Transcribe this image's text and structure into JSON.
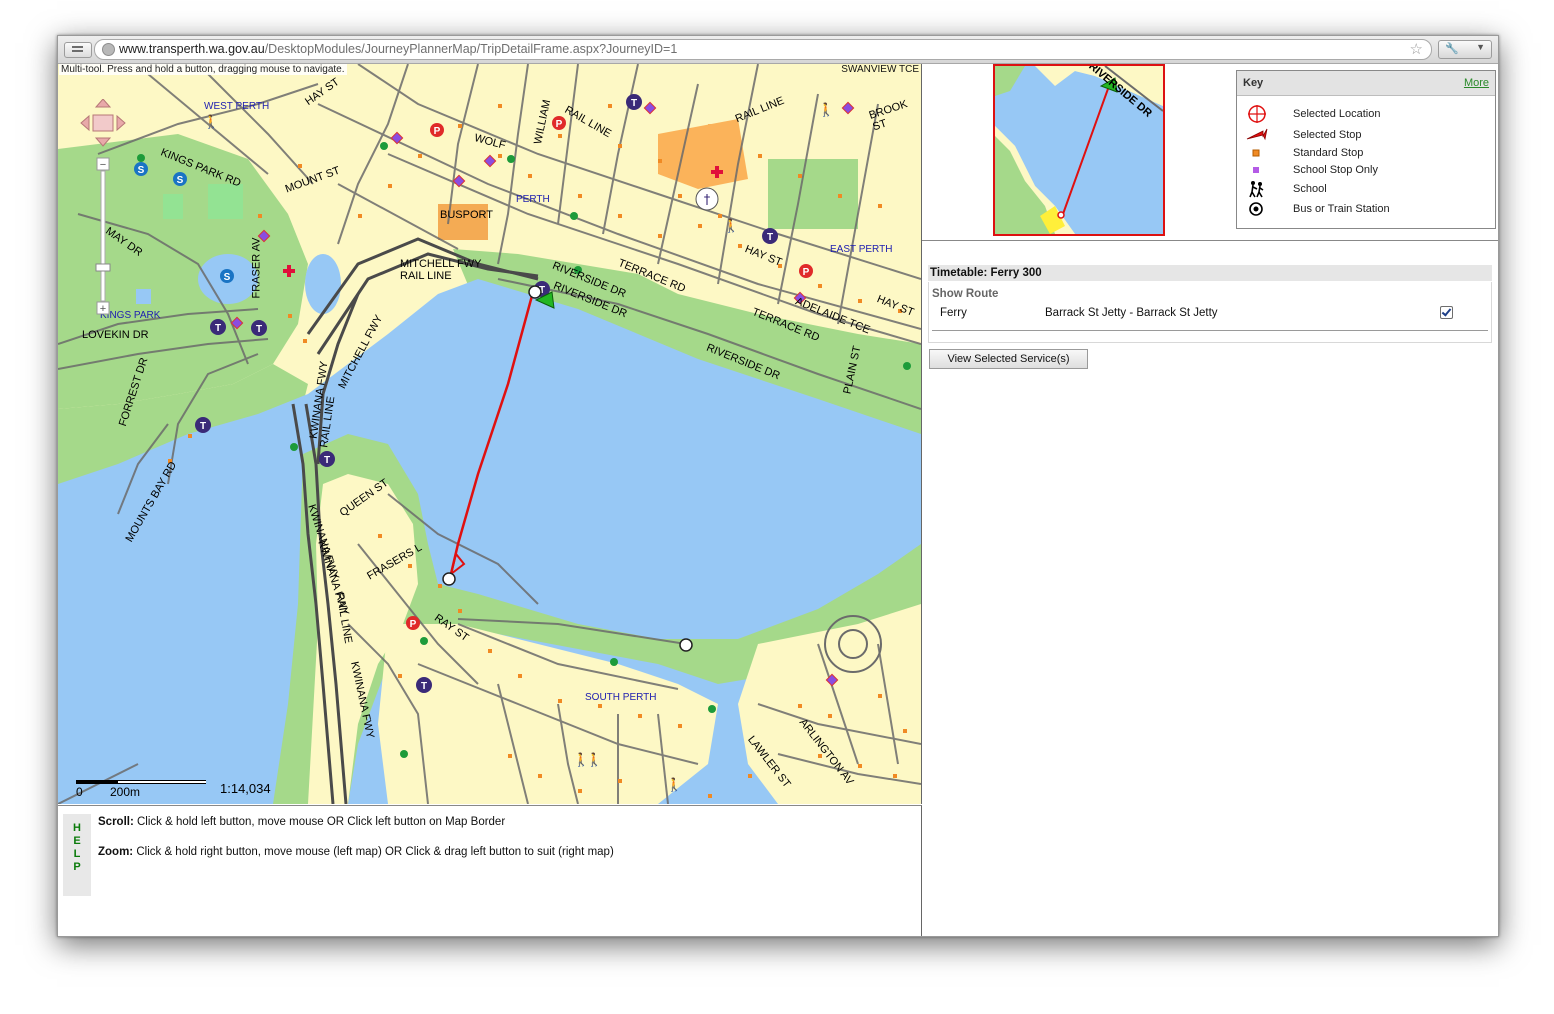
{
  "browser": {
    "url_host": "www.transperth.wa.gov.au",
    "url_path": "/DesktopModules/JourneyPlannerMap/TripDetailFrame.aspx?JourneyID=1"
  },
  "map": {
    "hint": "Multi-tool. Press and hold a button, dragging mouse to navigate.",
    "corner_label": "SWANVIEW TCE",
    "scale_zero": "0",
    "scale_distance": "200m",
    "scale_ratio": "1:14,034",
    "street_labels": {
      "hay_st_1": "HAY ST",
      "kings_park_rd": "KINGS PARK RD",
      "mount_st": "MOUNT ST",
      "may_dr": "MAY DR",
      "fraser_av": "FRASER AV",
      "lovekin_dr": "LOVEKIN DR",
      "forrest_dr": "FORREST DR",
      "mounts_bay_rd": "MOUNTS BAY RD",
      "kwinana_fwy_1": "KWINANA FWY",
      "kwinana_fwy_2": "KWINANA FWY",
      "kwinana_fwy_3": "KWINANA FWY",
      "kwinana_fwy_4": "KWINANA FWY",
      "rail_line_1": "RAIL LINE",
      "rail_line_2": "RAIL LINE",
      "rail_line_3": "RAIL LINE",
      "rail_line_4": "RAIL LINE",
      "rail_line_5": "RAIL LINE",
      "mitchell_fwy_1": "MITCHELL FWY",
      "mitchell_fwy_2": "MITCHELL FWY",
      "queen_st": "QUEEN ST",
      "frasers_l": "FRASERS L",
      "ray_st": "RAY ST",
      "riverside_dr_1": "RIVERSIDE DR",
      "riverside_dr_2": "RIVERSIDE DR",
      "riverside_dr_3": "RIVERSIDE DR",
      "terrace_rd_1": "TERRACE RD",
      "terrace_rd_2": "TERRACE RD",
      "hay_st_2": "HAY ST",
      "hay_st_3": "HAY ST",
      "adelaide_tce": "ADELAIDE TCE",
      "plain_st": "PLAIN ST",
      "brook_st": "BROOK ST",
      "william": "WILLIAM",
      "wolf": "WOLF",
      "busport": "BUSPORT",
      "lawler_st": "LAWLER ST",
      "arlington_av": "ARLINGTON AV"
    },
    "suburbs": {
      "west_perth": "WEST PERTH",
      "kings_park": "KINGS PARK",
      "perth": "PERTH",
      "east_perth": "EAST PERTH",
      "south_perth": "SOUTH PERTH"
    }
  },
  "locator": {
    "street_label": "RIVERSIDE DR"
  },
  "key": {
    "title": "Key",
    "more_link": "More",
    "items": [
      {
        "label": "Selected Location",
        "icon": "crosshair-icon"
      },
      {
        "label": "Selected Stop",
        "icon": "red-arrow-icon"
      },
      {
        "label": "Standard Stop",
        "icon": "orange-square-icon"
      },
      {
        "label": "School Stop Only",
        "icon": "purple-square-icon"
      },
      {
        "label": "School",
        "icon": "children-icon"
      },
      {
        "label": "Bus or Train Station",
        "icon": "target-icon"
      }
    ]
  },
  "timetable": {
    "heading": "Timetable: Ferry 300",
    "show_route": "Show Route",
    "service_type": "Ferry",
    "service_name": "Barrack St Jetty - Barrack St Jetty",
    "service_checked": true,
    "view_button": "View Selected Service(s)"
  },
  "help": {
    "tab_letters": [
      "H",
      "E",
      "L",
      "P"
    ],
    "scroll_label": "Scroll:",
    "scroll_text": " Click & hold left button, move mouse OR Click left button on Map Border",
    "zoom_label": "Zoom:",
    "zoom_text": " Click & hold right button, move mouse (left map) OR Click & drag left button to suit (right map)"
  },
  "colors": {
    "land": "#fdf8c5",
    "water": "#97c8f5",
    "park": "#a5d98a",
    "road": "#6b6b6b",
    "route": "#e01010",
    "stop": "#f08a24",
    "school_stop": "#8a4de0",
    "link_green": "#2a8a2a"
  }
}
